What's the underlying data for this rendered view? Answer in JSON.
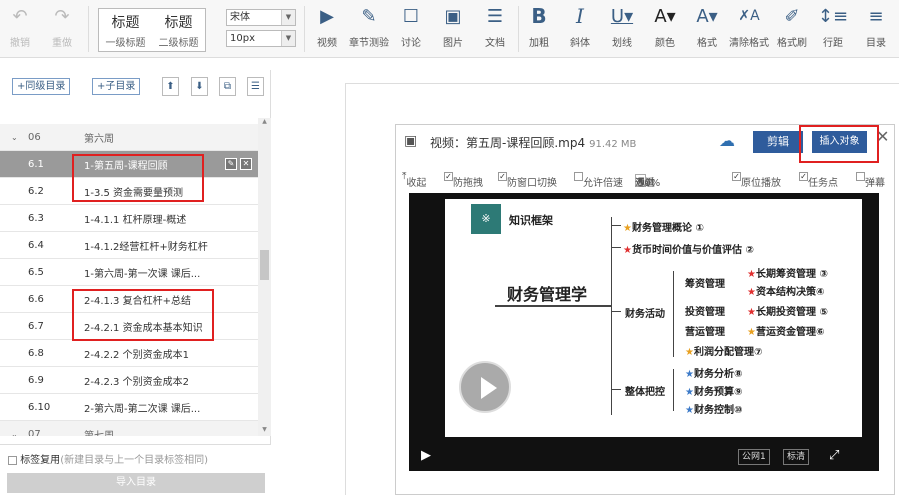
{
  "toolbar": {
    "undo": "撤销",
    "redo": "重做",
    "heading1_big": "标题",
    "heading1_small": "一级标题",
    "heading2_big": "标题",
    "heading2_small": "二级标题",
    "font_family": "宋体",
    "font_size": "10px",
    "video": "视频",
    "chapter_quiz": "章节测验",
    "discuss": "讨论",
    "image": "图片",
    "document": "文档",
    "bold": "加粗",
    "italic": "斜体",
    "underline": "划线",
    "color": "颜色",
    "format": "格式",
    "clear_format": "清除格式",
    "format_painter": "格式刷",
    "line_height": "行距",
    "catalog": "目录"
  },
  "left": {
    "add_same_level": "+同级目录",
    "add_child": "+子目录",
    "rows": [
      {
        "num": "06",
        "title": "第六周",
        "section": true
      },
      {
        "num": "6.1",
        "title": "1-第五周-课程回顾",
        "selected": true
      },
      {
        "num": "6.2",
        "title": "1-3.5 资金需要量预测"
      },
      {
        "num": "6.3",
        "title": "1-4.1.1 杠杆原理-概述"
      },
      {
        "num": "6.4",
        "title": "1-4.1.2经营杠杆+财务杠杆"
      },
      {
        "num": "6.5",
        "title": "1-第六周-第一次课 课后..."
      },
      {
        "num": "6.6",
        "title": "2-4.1.3 复合杠杆+总结"
      },
      {
        "num": "6.7",
        "title": "2-4.2.1 资金成本基本知识"
      },
      {
        "num": "6.8",
        "title": "2-4.2.2 个别资金成本1"
      },
      {
        "num": "6.9",
        "title": "2-4.2.3 个别资金成本2"
      },
      {
        "num": "6.10",
        "title": "2-第六周-第二次课 课后..."
      },
      {
        "num": "07",
        "title": "第七周",
        "section": true
      }
    ],
    "reuse_label": "标签复用",
    "reuse_hint": "(新建目录与上一个目录标签相同)",
    "import_button": "导入目录"
  },
  "video": {
    "title": "视频：第五周-课程回顾.mp4",
    "size": "91.42 MB",
    "edit": "剪辑",
    "insert": "插入对象",
    "collapse": "收起",
    "anti_drag": "防拖拽",
    "anti_switch": "防窗口切换",
    "allow_speed": "允许倍速",
    "watch_pre": "观看",
    "watch_val": "90%",
    "watch_post": "通过",
    "resume": "原位播放",
    "task_point": "任务点",
    "danmaku": "弹幕",
    "network": "公网1",
    "quality": "标清"
  },
  "mindmap": {
    "header": "知识框架",
    "root": "财务管理学",
    "n1": "财务管理概论 ①",
    "n2": "货币时间价值与价值评估 ②",
    "n3": "财务活动",
    "n4": "筹资管理",
    "n5": "长期筹资管理 ③",
    "n6": "资本结构决策④",
    "n7": "投资管理",
    "n8": "长期投资管理 ⑤",
    "n9": "营运管理",
    "n10": "营运资金管理⑥",
    "n11": "利润分配管理⑦",
    "n12": "整体把控",
    "n13": "财务分析⑧",
    "n14": "财务预算⑨",
    "n15": "财务控制⑩"
  }
}
